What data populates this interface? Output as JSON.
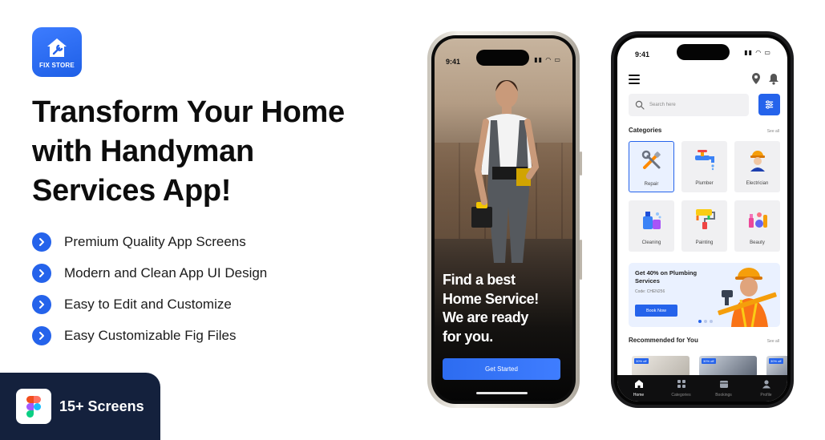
{
  "brand": {
    "logo_text": "FIX STORE",
    "accent": "#2563eb"
  },
  "headline": {
    "line1": "Transform Your Home",
    "line2": "with Handyman",
    "line3": "Services App!"
  },
  "features": [
    "Premium Quality App Screens",
    "Modern and Clean App UI Design",
    "Easy to Edit and Customize",
    "Easy Customizable Fig Files"
  ],
  "badge": {
    "label": "15+ Screens",
    "icon": "figma-icon"
  },
  "phone1": {
    "time": "9:41",
    "title_lines": [
      "Find a best",
      "Home Service!",
      "We are ready",
      "for you."
    ],
    "cta": "Get Started"
  },
  "phone2": {
    "time": "9:41",
    "search_placeholder": "Search here",
    "categories_title": "Categories",
    "see_all": "See all",
    "categories": [
      {
        "label": "Repair",
        "icon": "tools-icon"
      },
      {
        "label": "Plumber",
        "icon": "faucet-icon"
      },
      {
        "label": "Electrician",
        "icon": "electrician-icon"
      },
      {
        "label": "Cleaning",
        "icon": "cleaning-icon"
      },
      {
        "label": "Painting",
        "icon": "paint-roller-icon"
      },
      {
        "label": "Beauty",
        "icon": "beauty-icon"
      }
    ],
    "promo": {
      "title": "Get 40% on Plumbing Services",
      "code": "Code: CHEN256",
      "button": "Book Now"
    },
    "recommended_title": "Recommended for You",
    "recommended_see_all": "See all",
    "badges": [
      "30% off",
      "30% off",
      "30% off"
    ],
    "tabs": [
      "Home",
      "Categories",
      "Bookings",
      "Profile"
    ]
  }
}
